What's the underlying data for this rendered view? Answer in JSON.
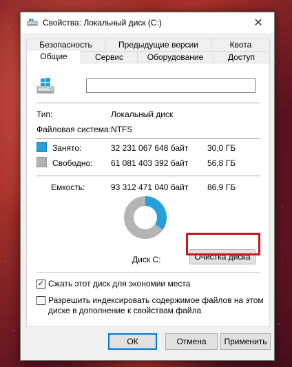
{
  "window": {
    "title": "Свойства: Локальный диск (C:)",
    "close_symbol": "✕"
  },
  "tabs_back": [
    {
      "label": "Безопасность"
    },
    {
      "label": "Предыдущие версии"
    },
    {
      "label": "Квота"
    }
  ],
  "tabs_front": [
    {
      "label": "Общие",
      "active": true
    },
    {
      "label": "Сервис",
      "active": false
    },
    {
      "label": "Оборудование",
      "active": false
    },
    {
      "label": "Доступ",
      "active": false
    }
  ],
  "general": {
    "volume_label_value": "",
    "type_label": "Тип:",
    "type_value": "Локальный диск",
    "fs_label": "Файловая система:",
    "fs_value": "NTFS",
    "used_label": "Занято:",
    "used_bytes": "32 231 067 648 байт",
    "used_size": "30,0 ГБ",
    "free_label": "Свободно:",
    "free_bytes": "61 081 403 392 байт",
    "free_size": "56,8 ГБ",
    "capacity_label": "Емкость:",
    "capacity_bytes": "93 312 471 040 байт",
    "capacity_size": "86,9 ГБ",
    "used_fraction": 0.345,
    "used_color": "#26a0da",
    "free_color": "#b4b4b4",
    "disk_label": "Диск C:",
    "cleanup_button": "Очистка диска",
    "compress_label": "Сжать этот диск для экономии места",
    "compress_checked": true,
    "index_label_line1": "Разрешить индексировать содержимое файлов на этом",
    "index_label_line2": "диске в дополнение к свойствам файла",
    "index_checked": false
  },
  "footer": {
    "ok": "ОК",
    "cancel": "Отмена",
    "apply": "Применить"
  },
  "icons": {
    "title": "drive-icon",
    "close": "close-icon",
    "drive": "windows-drive-icon"
  }
}
